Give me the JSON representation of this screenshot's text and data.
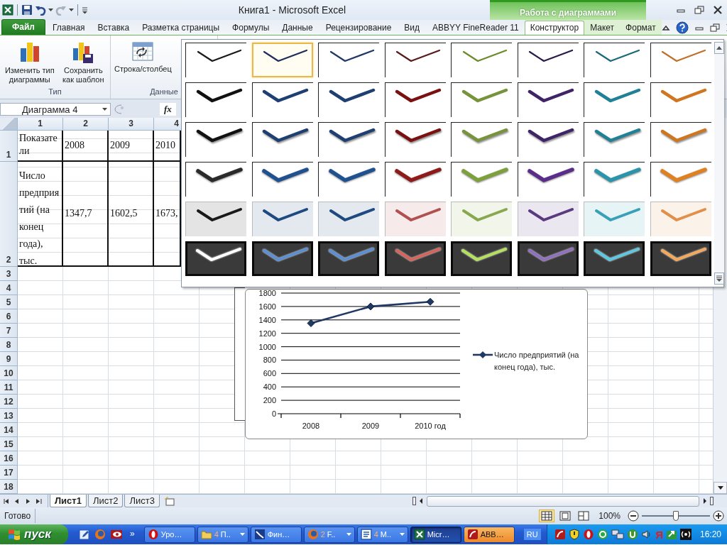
{
  "title_bar": {
    "title": "Книга1 - Microsoft Excel",
    "context_group": "Работа с диаграммами"
  },
  "ribbon_tabs": [
    {
      "label": "Файл",
      "kind": "file",
      "selected": false
    },
    {
      "label": "Главная",
      "kind": "main",
      "selected": false
    },
    {
      "label": "Вставка",
      "kind": "main",
      "selected": false
    },
    {
      "label": "Разметка страницы",
      "kind": "main",
      "selected": false
    },
    {
      "label": "Формулы",
      "kind": "main",
      "selected": false
    },
    {
      "label": "Данные",
      "kind": "main",
      "selected": false
    },
    {
      "label": "Рецензирование",
      "kind": "main",
      "selected": false
    },
    {
      "label": "Вид",
      "kind": "main",
      "selected": false
    },
    {
      "label": "ABBYY FineReader 11",
      "kind": "main",
      "selected": false
    },
    {
      "label": "Конструктор",
      "kind": "context",
      "selected": true
    },
    {
      "label": "Макет",
      "kind": "context",
      "selected": false
    },
    {
      "label": "Формат",
      "kind": "context",
      "selected": false
    }
  ],
  "ribbon_groups": [
    {
      "label": "Тип",
      "buttons": [
        {
          "label": "Изменить тип диаграммы",
          "kind": "change_type"
        },
        {
          "label": "Сохранить как шаблон",
          "kind": "save_template"
        }
      ]
    },
    {
      "label": "Данные",
      "buttons": [
        {
          "label": "Строка/столбец",
          "kind": "switch"
        }
      ]
    }
  ],
  "formula_bar": {
    "name_box": "Диаграмма 4",
    "function_button": "fx"
  },
  "sheet": {
    "columns": [
      "1",
      "2",
      "3",
      "4"
    ],
    "rows": [
      {
        "header": "1",
        "cells": [
          "Показатели",
          "2008",
          "2009",
          "2010"
        ]
      },
      {
        "header": "2",
        "cells": [
          "Число предприятий (на конец года), тыс.",
          "1347,7",
          "1602,5",
          "1673,"
        ]
      }
    ],
    "empty_rows": [
      "3",
      "4",
      "5",
      "6",
      "7",
      "8",
      "9",
      "10",
      "11",
      "12",
      "13",
      "14",
      "15",
      "16",
      "17",
      "18"
    ]
  },
  "chart": {
    "chart_data": {
      "type": "line",
      "categories": [
        "2008",
        "2009",
        "2010 год"
      ],
      "series": [
        {
          "name": "Число предприятий (на конец года), тыс.",
          "color": "#1f3864",
          "marker": "diamond",
          "values": [
            1350,
            1600,
            1670
          ]
        }
      ],
      "grid": true,
      "ylim": [
        0,
        1800
      ],
      "yticks": [
        0,
        200,
        400,
        600,
        800,
        1000,
        1200,
        1400,
        1600,
        1800
      ]
    }
  },
  "style_gallery": {
    "rows": [
      {
        "kind": "thin",
        "styles": [
          {
            "color": "#1a1a1a",
            "selected": false
          },
          {
            "color": "#1f2d5a",
            "selected": true
          },
          {
            "color": "#1f3864",
            "selected": false
          },
          {
            "color": "#5a1a1a",
            "selected": false
          },
          {
            "color": "#6b8a2a",
            "selected": false
          },
          {
            "color": "#2a1a4a",
            "selected": false
          },
          {
            "color": "#1a6a7a",
            "selected": false
          },
          {
            "color": "#c0702a",
            "selected": false
          }
        ]
      },
      {
        "kind": "thick",
        "styles": [
          {
            "color": "#111111",
            "selected": false
          },
          {
            "color": "#1f3f73",
            "selected": false
          },
          {
            "color": "#1f3f73",
            "selected": false
          },
          {
            "color": "#7a1010",
            "selected": false
          },
          {
            "color": "#77933c",
            "selected": false
          },
          {
            "color": "#3f2466",
            "selected": false
          },
          {
            "color": "#1f8096",
            "selected": false
          },
          {
            "color": "#d07520",
            "selected": false
          }
        ]
      },
      {
        "kind": "shadow",
        "styles": [
          {
            "color": "#111111",
            "selected": false
          },
          {
            "color": "#1f3f73",
            "selected": false
          },
          {
            "color": "#1f3f73",
            "selected": false
          },
          {
            "color": "#7a1010",
            "selected": false
          },
          {
            "color": "#77933c",
            "selected": false
          },
          {
            "color": "#3f2466",
            "selected": false
          },
          {
            "color": "#1f8096",
            "selected": false
          },
          {
            "color": "#d07520",
            "selected": false
          }
        ]
      },
      {
        "kind": "bevel",
        "styles": [
          {
            "color": "#2a2a2a",
            "selected": false
          },
          {
            "color": "#1f5090",
            "selected": false
          },
          {
            "color": "#1f5090",
            "selected": false
          },
          {
            "color": "#8e1a1a",
            "selected": false
          },
          {
            "color": "#7ea03c",
            "selected": false
          },
          {
            "color": "#5a2d8a",
            "selected": false
          },
          {
            "color": "#2a95aa",
            "selected": false
          },
          {
            "color": "#e0801f",
            "selected": false
          }
        ]
      },
      {
        "kind": "tinted",
        "styles": [
          {
            "color": "#1a1a1a",
            "selected": false
          },
          {
            "color": "#1f4a80",
            "selected": false
          },
          {
            "color": "#1f4a80",
            "selected": false
          },
          {
            "color": "#b05050",
            "selected": false
          },
          {
            "color": "#88a850",
            "selected": false
          },
          {
            "color": "#5a3a80",
            "selected": false
          },
          {
            "color": "#3aa0b8",
            "selected": false
          },
          {
            "color": "#e0904a",
            "selected": false
          }
        ]
      },
      {
        "kind": "dark",
        "styles": [
          {
            "color": "#ffffff",
            "selected": false
          },
          {
            "color": "#5b8fd4",
            "selected": false
          },
          {
            "color": "#5b8fd4",
            "selected": false
          },
          {
            "color": "#d9625a",
            "selected": false
          },
          {
            "color": "#b4e05a",
            "selected": false
          },
          {
            "color": "#9070c0",
            "selected": false
          },
          {
            "color": "#5ac8e0",
            "selected": false
          },
          {
            "color": "#f5a858",
            "selected": false
          }
        ]
      }
    ]
  },
  "sheet_tabs": [
    {
      "label": "Лист1",
      "selected": true
    },
    {
      "label": "Лист2",
      "selected": false
    },
    {
      "label": "Лист3",
      "selected": false
    }
  ],
  "status_bar": {
    "text": "Готово",
    "views": [
      {
        "kind": "normal",
        "selected": true
      },
      {
        "kind": "layout",
        "selected": false
      },
      {
        "kind": "pagebreak",
        "selected": false
      }
    ],
    "zoom": "100%",
    "zoom_slider": {
      "level": 0.5
    }
  },
  "taskbar": {
    "start": "пуск",
    "quick_launch": [
      {
        "kind": "edit"
      },
      {
        "kind": "firefox"
      },
      {
        "kind": "eye"
      }
    ],
    "overflow": "»",
    "tasks": [
      {
        "label": "Уро…",
        "kind": "opera",
        "selected": false,
        "flashing": false
      },
      {
        "count": "4",
        "label": "П..",
        "kind": "folder",
        "selected": false,
        "flashing": false
      },
      {
        "label": "Фин…",
        "kind": "finance",
        "selected": false,
        "flashing": false
      },
      {
        "count": "2",
        "label": "F..",
        "kind": "firefox",
        "selected": false,
        "flashing": false
      },
      {
        "count": "4",
        "label": "M..",
        "kind": "word",
        "selected": false,
        "flashing": false
      },
      {
        "label": "Micr…",
        "kind": "excel",
        "selected": true,
        "flashing": false
      },
      {
        "label": "ABB…",
        "kind": "abbyy",
        "selected": false,
        "flashing": true
      }
    ],
    "language": "RU",
    "tray": [
      {
        "kind": "abbyy"
      },
      {
        "kind": "shield"
      },
      {
        "kind": "opera"
      },
      {
        "kind": "at"
      },
      {
        "kind": "network"
      },
      {
        "kind": "torrent"
      },
      {
        "kind": "speaker"
      },
      {
        "kind": "glyph",
        "text": "Я"
      },
      {
        "kind": "arrowbox"
      },
      {
        "kind": "signal"
      }
    ],
    "clock": "16:20"
  }
}
